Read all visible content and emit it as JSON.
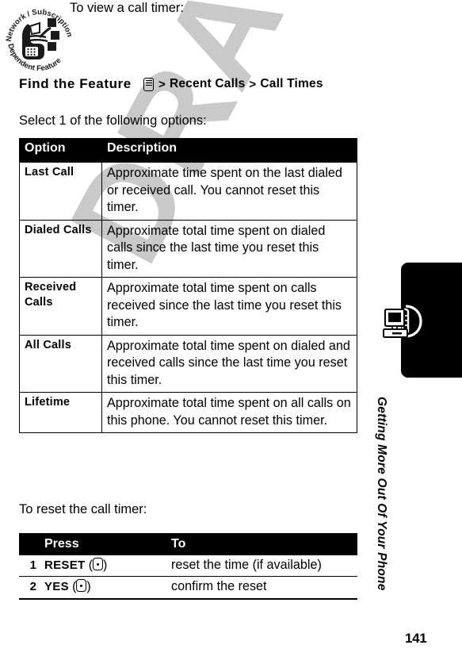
{
  "badge": {
    "name": "network-subscription-dependent-feature",
    "top_text": "Network / Subscription",
    "bottom_text": "Dependent  Feature"
  },
  "intro": {
    "text": "To view a call timer:"
  },
  "find_the_feature": {
    "label": "Find the Feature",
    "menu_icon": "menu-key-icon",
    "separator": ">",
    "path": [
      "Recent Calls",
      "Call Times"
    ]
  },
  "select_line": {
    "text": "Select 1 of the following options:"
  },
  "options_table": {
    "headers": [
      "Option",
      "Description"
    ],
    "rows": [
      {
        "option": "Last Call",
        "description": "Approximate time spent on the last dialed or received call. You cannot reset this timer."
      },
      {
        "option": "Dialed Calls",
        "description": "Approximate total time spent on dialed calls since the last time you reset this timer."
      },
      {
        "option": "Received Calls",
        "description": "Approximate total time spent on calls received since the last time you reset this timer."
      },
      {
        "option": "All Calls",
        "description": "Approximate total time spent on dialed and received calls since the last time you reset this timer."
      },
      {
        "option": "Lifetime",
        "description": "Approximate total time spent on all calls on this phone. You cannot reset this timer."
      }
    ]
  },
  "reset_line": {
    "text": "To reset the call timer:"
  },
  "steps_table": {
    "headers": [
      "",
      "Press",
      "To"
    ],
    "rows": [
      {
        "num": "1",
        "key": "RESET",
        "key_icon": "softkey-icon",
        "open_paren": "(",
        "close_paren": ")",
        "to": "reset the time (if available)"
      },
      {
        "num": "2",
        "key": "YES",
        "key_icon": "softkey-icon",
        "open_paren": "(",
        "close_paren": ")",
        "to": "confirm the reset"
      }
    ]
  },
  "chapter": {
    "title": "Getting More Out Of Your Phone",
    "tab_icon": "computer-phone-icon",
    "page_number": "141"
  },
  "watermark": {
    "text": "DRAFT"
  },
  "colors": {
    "ink": "#000000",
    "paper": "#ffffff",
    "watermark": "#c9c9c9"
  }
}
